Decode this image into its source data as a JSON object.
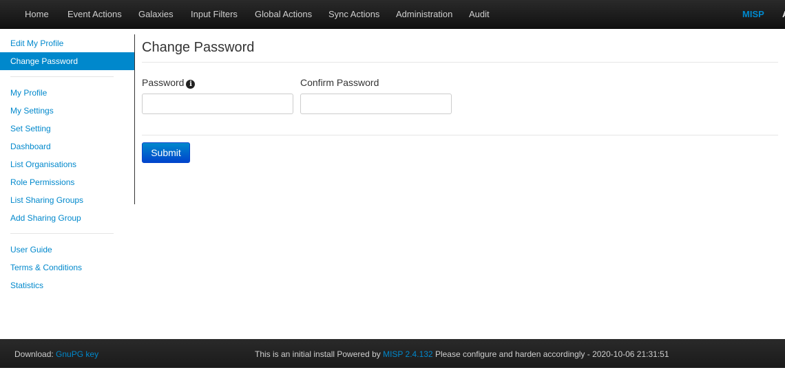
{
  "topnav": {
    "items": [
      "Home",
      "Event Actions",
      "Galaxies",
      "Input Filters",
      "Global Actions",
      "Sync Actions",
      "Administration",
      "Audit"
    ],
    "brand": "MISP",
    "cut_label": "A"
  },
  "sidebar": {
    "group1": [
      "Edit My Profile",
      "Change Password"
    ],
    "group2": [
      "My Profile",
      "My Settings",
      "Set Setting",
      "Dashboard",
      "List Organisations",
      "Role Permissions",
      "List Sharing Groups",
      "Add Sharing Group"
    ],
    "group3": [
      "User Guide",
      "Terms & Conditions",
      "Statistics"
    ],
    "active": "Change Password"
  },
  "main": {
    "title": "Change Password",
    "password_label": "Password",
    "info_glyph": "i",
    "confirm_label": "Confirm Password",
    "password_value": "",
    "confirm_value": "",
    "submit_label": "Submit"
  },
  "footer": {
    "download_prefix": "Download:",
    "download_link": "GnuPG key",
    "powered_prefix": "This is an initial install Powered by",
    "powered_link": "MISP 2.4.132",
    "powered_suffix": "Please configure and harden accordingly - 2020-10-06 21:31:51"
  },
  "colors": {
    "accent": "#0088cc",
    "nav_bg": "#1c1c1c",
    "nav_text": "#cfcfcf"
  }
}
